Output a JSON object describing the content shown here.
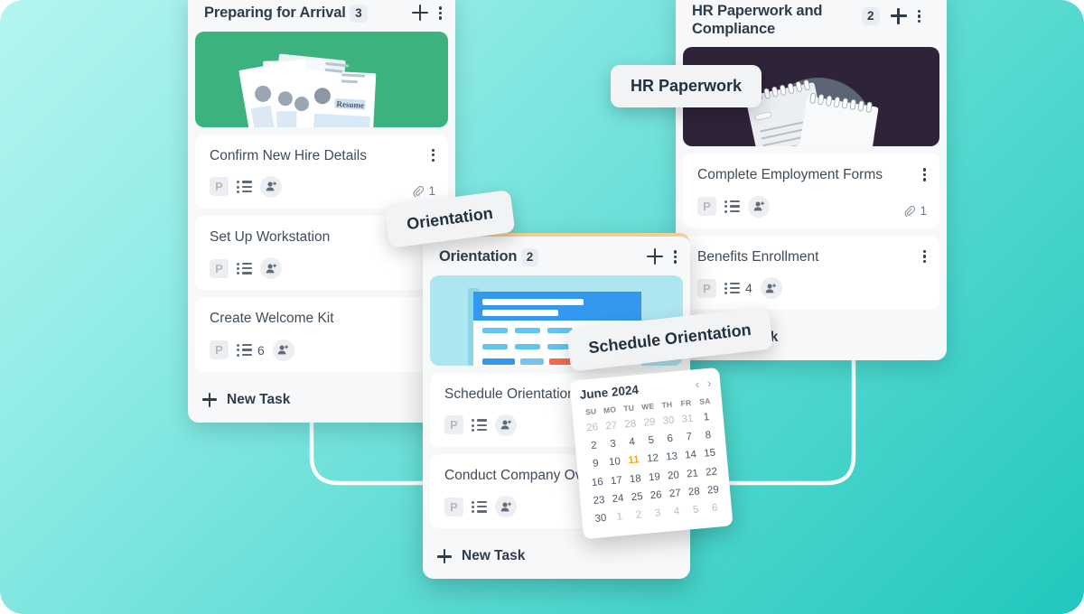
{
  "background": {
    "gradient_from": "#b4f5f0",
    "gradient_to": "#22c7bd"
  },
  "columns": [
    {
      "id": "preparing-for-arrival",
      "title": "Preparing for Arrival",
      "count": "3",
      "add_icon": "plus-icon",
      "menu_icon": "kebab-icon",
      "thumbnail": {
        "name": "resume-documents-thumbnail",
        "bg": "#3cb37e"
      },
      "new_task_label": "New Task",
      "cards": [
        {
          "title": "Confirm New Hire Details",
          "priority": "P",
          "checklist_count": "",
          "attachment_count": "1"
        },
        {
          "title": "Set Up Workstation",
          "priority": "P",
          "checklist_count": "",
          "attachment_count": ""
        },
        {
          "title": "Create Welcome Kit",
          "priority": "P",
          "checklist_count": "6",
          "attachment_count": ""
        }
      ]
    },
    {
      "id": "hr-paperwork-and-compliance",
      "title": "HR Paperwork and Compliance",
      "count": "2",
      "add_icon": "plus-icon",
      "menu_icon": "kebab-icon",
      "thumbnail": {
        "name": "notepads-thumbnail",
        "bg": "#2f2338"
      },
      "new_task_label": "New Task",
      "cards": [
        {
          "title": "Complete Employment Forms",
          "priority": "P",
          "checklist_count": "",
          "attachment_count": "1"
        },
        {
          "title": "Benefits Enrollment",
          "priority": "P",
          "checklist_count": "4",
          "attachment_count": ""
        }
      ]
    },
    {
      "id": "orientation",
      "title": "Orientation",
      "count": "2",
      "add_icon": "plus-icon",
      "menu_icon": "kebab-icon",
      "accent_color": "#f0cf94",
      "thumbnail": {
        "name": "calendar-form-thumbnail",
        "bg": "#aee6f0"
      },
      "new_task_label": "New Task",
      "cards": [
        {
          "title": "Schedule Orientation",
          "priority": "P",
          "checklist_count": "",
          "attachment_count": ""
        },
        {
          "title": "Conduct Company Overview",
          "priority": "P",
          "checklist_count": "",
          "attachment_count": ""
        }
      ]
    }
  ],
  "floating_labels": [
    {
      "id": "orientation-label",
      "text": "Orientation"
    },
    {
      "id": "hr-paperwork-label",
      "text": "HR Paperwork"
    },
    {
      "id": "schedule-orientation-label",
      "text": "Schedule Orientation"
    }
  ],
  "calendar": {
    "month": "June 2024",
    "prev_icon": "chevron-left-icon",
    "next_icon": "chevron-right-icon",
    "weekdays": [
      "SU",
      "MO",
      "TU",
      "WE",
      "TH",
      "FR",
      "SA"
    ],
    "today": "11",
    "highlight_color": "#f5a623",
    "weeks": [
      [
        {
          "d": "26",
          "m": true
        },
        {
          "d": "27",
          "m": true
        },
        {
          "d": "28",
          "m": true
        },
        {
          "d": "29",
          "m": true
        },
        {
          "d": "30",
          "m": true
        },
        {
          "d": "31",
          "m": true
        },
        {
          "d": "1",
          "m": false
        }
      ],
      [
        {
          "d": "2",
          "m": false
        },
        {
          "d": "3",
          "m": false
        },
        {
          "d": "4",
          "m": false
        },
        {
          "d": "5",
          "m": false
        },
        {
          "d": "6",
          "m": false
        },
        {
          "d": "7",
          "m": false
        },
        {
          "d": "8",
          "m": false
        }
      ],
      [
        {
          "d": "9",
          "m": false
        },
        {
          "d": "10",
          "m": false
        },
        {
          "d": "11",
          "m": false
        },
        {
          "d": "12",
          "m": false
        },
        {
          "d": "13",
          "m": false
        },
        {
          "d": "14",
          "m": false
        },
        {
          "d": "15",
          "m": false
        }
      ],
      [
        {
          "d": "16",
          "m": false
        },
        {
          "d": "17",
          "m": false
        },
        {
          "d": "18",
          "m": false
        },
        {
          "d": "19",
          "m": false
        },
        {
          "d": "20",
          "m": false
        },
        {
          "d": "21",
          "m": false
        },
        {
          "d": "22",
          "m": false
        }
      ],
      [
        {
          "d": "23",
          "m": false
        },
        {
          "d": "24",
          "m": false
        },
        {
          "d": "25",
          "m": false
        },
        {
          "d": "26",
          "m": false
        },
        {
          "d": "27",
          "m": false
        },
        {
          "d": "28",
          "m": false
        },
        {
          "d": "29",
          "m": false
        }
      ],
      [
        {
          "d": "30",
          "m": false
        },
        {
          "d": "1",
          "m": true
        },
        {
          "d": "2",
          "m": true
        },
        {
          "d": "3",
          "m": true
        },
        {
          "d": "4",
          "m": true
        },
        {
          "d": "5",
          "m": true
        },
        {
          "d": "6",
          "m": true
        }
      ]
    ]
  },
  "icons": {
    "priority": "priority-icon",
    "checklist": "checklist-icon",
    "assignee": "add-assignee-icon",
    "attachment": "paperclip-icon"
  }
}
